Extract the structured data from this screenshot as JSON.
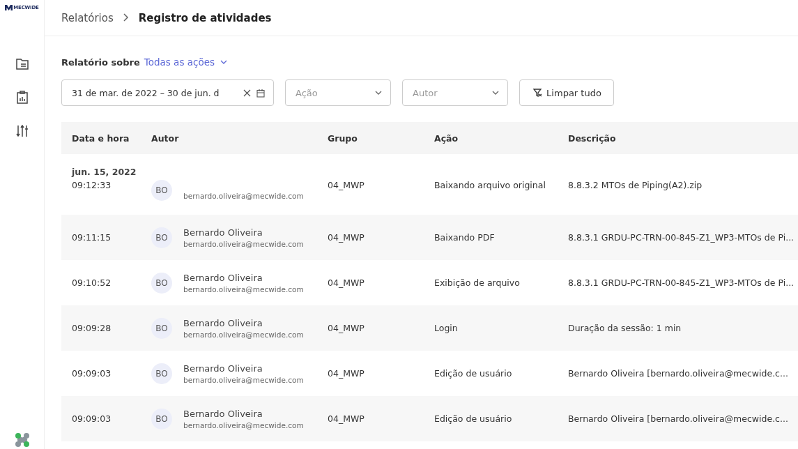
{
  "sidebar": {
    "logo_text": "MECWIDE",
    "items": [
      {
        "kind": "document",
        "selected": false
      },
      {
        "kind": "report",
        "selected": false
      },
      {
        "kind": "sliders",
        "selected": false
      }
    ]
  },
  "breadcrumb": [
    {
      "label": "Relatórios",
      "current": false
    },
    {
      "label": "Registro de atividades",
      "current": true
    }
  ],
  "report_about": {
    "label": "Relatório sobre",
    "value": "Todas as ações"
  },
  "filters": {
    "date_range": "31 de mar. de 2022 – 30 de jun. d",
    "action_placeholder": "Ação",
    "author_placeholder": "Autor",
    "clear_button": "Limpar tudo"
  },
  "table": {
    "columns": [
      "Data e hora",
      "Autor",
      "Grupo",
      "Ação",
      "Descrição"
    ],
    "group": "jun. 15, 2022",
    "rows": [
      {
        "time": "09:12:33",
        "initials": "BO",
        "email": "bernardo.oliveira@mecwide.com",
        "group": "04_MWP",
        "action": "Baixando arquivo original",
        "description": "8.8.3.2 MTOs de Piping(A2).zip"
      },
      {
        "time": "09:11:15",
        "initials": "BO",
        "name": "Bernardo Oliveira",
        "email": "bernardo.oliveira@mecwide.com",
        "group": "04_MWP",
        "action": "Baixando PDF",
        "description": "8.8.3.1 GRDU-PC-TRN-00-845-Z1_WP3-MTOs de Pi..."
      },
      {
        "time": "09:10:52",
        "initials": "BO",
        "name": "Bernardo Oliveira",
        "email": "bernardo.oliveira@mecwide.com",
        "group": "04_MWP",
        "action": "Exibição de arquivo",
        "description": "8.8.3.1 GRDU-PC-TRN-00-845-Z1_WP3-MTOs de Pi..."
      },
      {
        "time": "09:09:28",
        "initials": "BO",
        "name": "Bernardo Oliveira",
        "email": "bernardo.oliveira@mecwide.com",
        "group": "04_MWP",
        "action": "Login",
        "description": "Duração da sessão: 1 min"
      },
      {
        "time": "09:09:03",
        "initials": "BO",
        "name": "Bernardo Oliveira",
        "email": "bernardo.oliveira@mecwide.com",
        "group": "04_MWP",
        "action": "Edição de usuário",
        "description": "Bernardo Oliveira [bernardo.oliveira@mecwide.c..."
      },
      {
        "time": "09:09:03",
        "initials": "BO",
        "name": "Bernardo Oliveira",
        "email": "bernardo.oliveira@mecwide.com",
        "group": "04_MWP",
        "action": "Edição de usuário",
        "description": "Bernardo Oliveira [bernardo.oliveira@mecwide.c..."
      }
    ]
  }
}
